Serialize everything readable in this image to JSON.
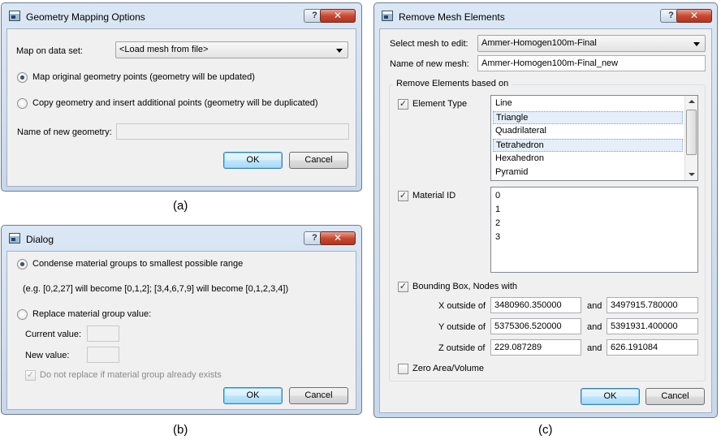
{
  "dialog_a": {
    "title": "Geometry Mapping Options",
    "help": "?",
    "close": "✕",
    "map_label": "Map on data set:",
    "map_value": "<Load mesh from file>",
    "radio1": "Map original geometry points (geometry will be updated)",
    "radio2": "Copy geometry and insert additional points (geometry will be duplicated)",
    "name_label": "Name of new geometry:",
    "name_value": "",
    "ok": "OK",
    "cancel": "Cancel",
    "caption": "(a)"
  },
  "dialog_b": {
    "title": "Dialog",
    "help": "?",
    "close": "✕",
    "radio1": "Condense material groups to smallest possible range",
    "example": "(e.g. [0,2,27] will become [0,1,2]; [3,4,6,7,9] will become [0,1,2,3,4])",
    "radio2": "Replace material group value:",
    "current_label": "Current value:",
    "new_label": "New value:",
    "current_value": "",
    "new_value": "",
    "checkbox": "Do not replace if material group already exists",
    "ok": "OK",
    "cancel": "Cancel",
    "caption": "(b)"
  },
  "dialog_c": {
    "title": "Remove Mesh Elements",
    "help": "?",
    "close": "✕",
    "select_label": "Select mesh to edit:",
    "select_value": "Ammer-Homogen100m-Final",
    "name_label": "Name of new mesh:",
    "name_value": "Ammer-Homogen100m-Final_new",
    "group_title": "Remove Elements based on",
    "element_type": "Element Type",
    "element_types": [
      "Line",
      "Triangle",
      "Quadrilateral",
      "Tetrahedron",
      "Hexahedron",
      "Pyramid"
    ],
    "material_id": "Material ID",
    "material_ids": [
      "0",
      "1",
      "2",
      "3"
    ],
    "bbox_label": "Bounding Box, Nodes with",
    "x_label": "X outside of",
    "y_label": "Y outside of",
    "z_label": "Z outside of",
    "and": "and",
    "x_min": "3480960.350000",
    "x_max": "3497915.780000",
    "y_min": "5375306.520000",
    "y_max": "5391931.400000",
    "z_min": "229.087289",
    "z_max": "626.191084",
    "zero_area": "Zero Area/Volume",
    "ok": "OK",
    "cancel": "Cancel",
    "caption": "(c)"
  }
}
